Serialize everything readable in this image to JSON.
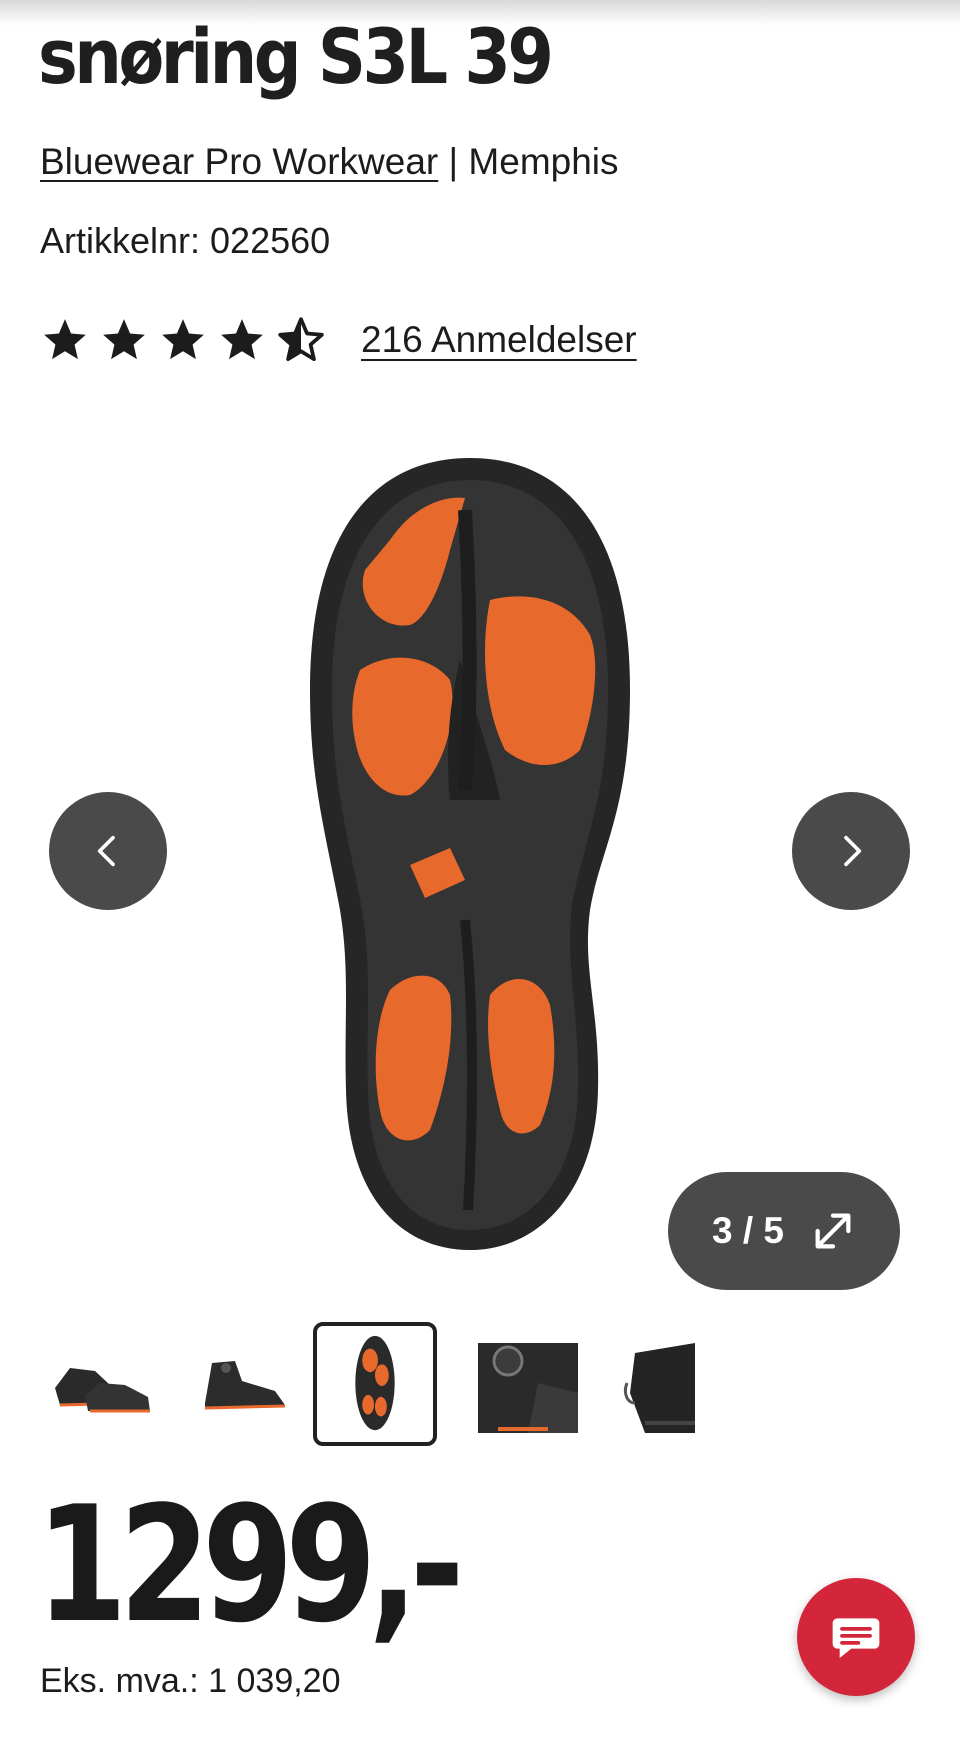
{
  "product": {
    "title": "snøring S3L 39",
    "brand": "Bluewear Pro Workwear",
    "separator": " | ",
    "model": "Memphis",
    "article_number_label": "Artikkelnr: 022560"
  },
  "rating": {
    "stars": 4.5,
    "max_stars": 5,
    "reviews_label": "216 Anmeldelser"
  },
  "gallery": {
    "counter": "3 / 5",
    "current": 3,
    "total": 5,
    "thumbnails": [
      {
        "name": "thumb-boot-pair"
      },
      {
        "name": "thumb-boot-side"
      },
      {
        "name": "thumb-boot-sole",
        "selected": true
      },
      {
        "name": "thumb-boot-closeup"
      },
      {
        "name": "thumb-boot-back"
      }
    ]
  },
  "price": {
    "main": "1299,-",
    "ex_vat": "Eks. mva.: 1 039,20"
  },
  "colors": {
    "sole_orange": "#e8692c",
    "sole_black": "#2a2a2a",
    "button_gray": "#4a4a4a",
    "chat_red": "#d3263a"
  },
  "icons": {
    "prev": "chevron-left-icon",
    "next": "chevron-right-icon",
    "expand": "expand-arrows-icon",
    "chat": "chat-bubble-icon"
  }
}
